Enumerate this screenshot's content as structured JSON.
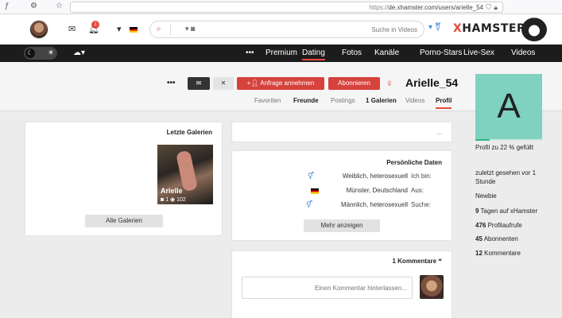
{
  "browser": {
    "url_prefix": "https://",
    "url_rest": "de.xhamster.com/users/arielle_54"
  },
  "header": {
    "notification_count": "1",
    "search_placeholder": "Suche in Videos",
    "logo_prefix": "X",
    "logo_main": "HAMSTER",
    "gender_icon": "trans-symbol-icon"
  },
  "nav": {
    "items": [
      "Videos",
      "Live-Sex",
      "Porno-Stars",
      "Kanäle",
      "Fotos",
      "Dating",
      "Premium",
      "•••"
    ]
  },
  "profile": {
    "avatar_letter": "A",
    "username": "Arielle_54",
    "subscribe_label": "Abonnieren",
    "friend_label": "Anfrage annehmen",
    "close_label": "✕",
    "message_label": "✉",
    "more_label": "•••",
    "tabs": [
      {
        "label": "Profil",
        "active": true
      },
      {
        "label": "Videos",
        "active": false
      },
      {
        "label": "Galerien",
        "count": "1",
        "active": false
      },
      {
        "label": "Postings",
        "active": false
      },
      {
        "label": "Freunde",
        "active": false
      },
      {
        "label": "Favoriten",
        "active": false
      }
    ]
  },
  "sidebar": {
    "completion_text": "Profil zu 22 % gefüllt",
    "completion": 0.22,
    "last_seen": "zuletzt gesehen vor 1 Stunde",
    "newbie": "Newbie",
    "days_value": "9",
    "days_label": "Tagen auf xHamster",
    "views_value": "476",
    "views_label": "Profilaufrufe",
    "subs_value": "45",
    "subs_label": "Abonnenten",
    "comments_value": "12",
    "comments_label": "Kommentare"
  },
  "status_card": {
    "text": "..."
  },
  "personal": {
    "title": "Persönliche Daten",
    "rows": [
      {
        "label": "Ich bin:",
        "value": "Weiblich, heterosexuell"
      },
      {
        "label": "Aus:",
        "value": "Münster, Deutschland"
      },
      {
        "label": "Suche:",
        "value": "Männlich, heterosexuell"
      }
    ],
    "more_label": "Mehr anzeigen"
  },
  "galleries": {
    "title": "Letzte Galerien",
    "thumb_caption": "Arielle",
    "thumb_photos": "1",
    "thumb_views": "102",
    "all_label": "Alle Galerien"
  },
  "comments": {
    "title": "Kommentare",
    "count": "1",
    "placeholder": "Einen Kommentar hinterlassen..."
  }
}
